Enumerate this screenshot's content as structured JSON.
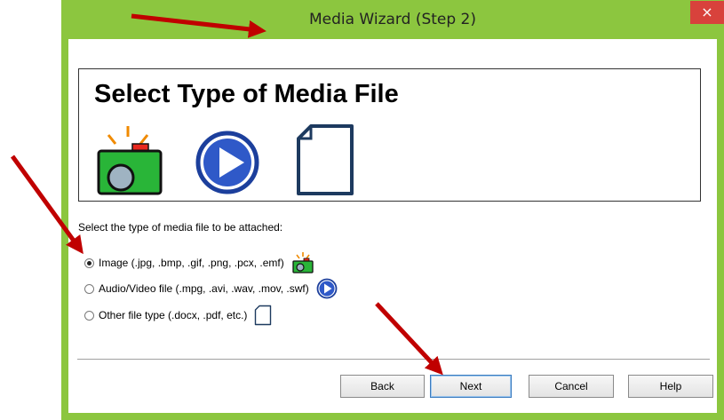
{
  "window": {
    "title": "Media Wizard (Step 2)",
    "close_label": "×"
  },
  "header": {
    "title": "Select Type of Media File",
    "icons": [
      "camera-icon",
      "play-icon",
      "document-icon"
    ]
  },
  "prompt": "Select the type of media file to be attached:",
  "options": [
    {
      "label": "Image (.jpg, .bmp, .gif, .png, .pcx, .emf)",
      "checked": true,
      "icon": "camera-icon"
    },
    {
      "label": "Audio/Video file (.mpg, .avi, .wav, .mov, .swf)",
      "checked": false,
      "icon": "play-icon"
    },
    {
      "label": "Other file type (.docx, .pdf, etc.)",
      "checked": false,
      "icon": "document-icon"
    }
  ],
  "buttons": {
    "back": "Back",
    "next": "Next",
    "cancel": "Cancel",
    "help": "Help"
  },
  "colors": {
    "frame": "#8cc63f",
    "close": "#d8423c",
    "annotation_arrow": "#c00000"
  }
}
